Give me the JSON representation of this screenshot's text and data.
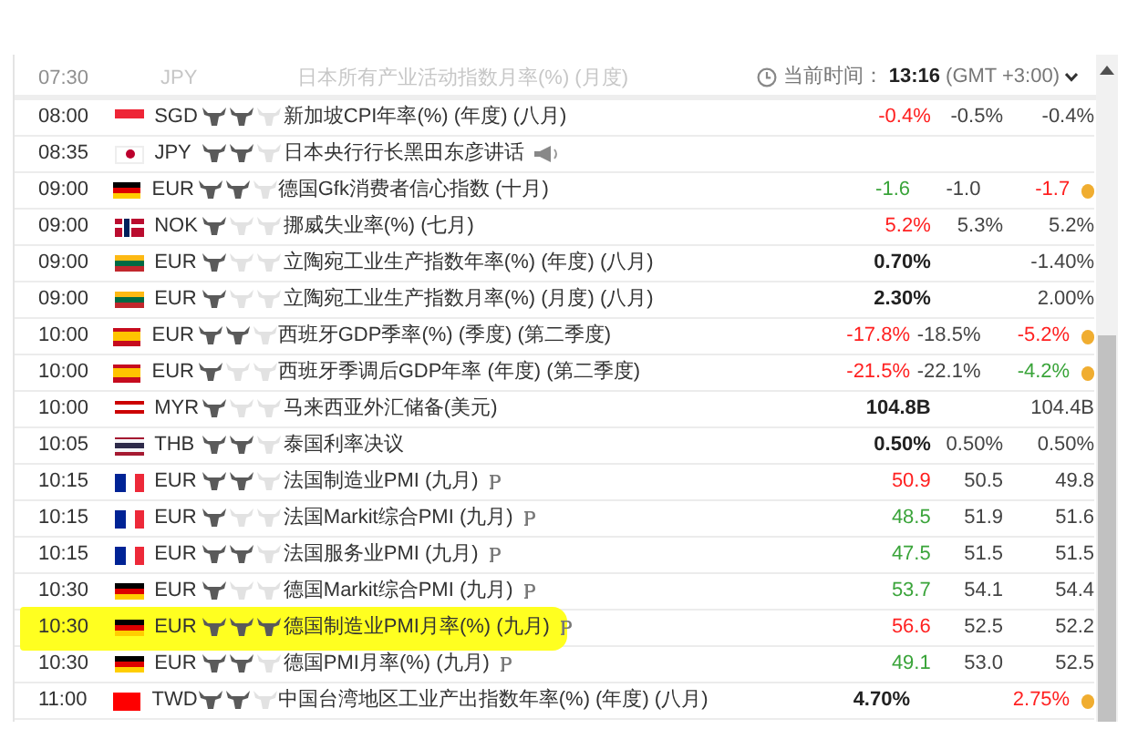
{
  "header": {
    "time_label": "当前时间：",
    "time": "13:16",
    "timezone": "(GMT +3:00)"
  },
  "ghost_row": {
    "time": "07:30",
    "currency": "JPY",
    "event": "日本所有产业活动指数月率(%) (月度)",
    "faded": true
  },
  "rows": [
    {
      "time": "08:00",
      "flag": {
        "kind": "sg"
      },
      "currency": "SGD",
      "stars": 2,
      "event": "新加坡CPI年率(%) (年度) (八月)",
      "prelim": false,
      "speech": false,
      "actual": {
        "text": "-0.4%",
        "color": "#ff2020",
        "bold": false
      },
      "forecast": "-0.5%",
      "previous": {
        "text": "-0.4%",
        "color": "#444444"
      },
      "revised": false,
      "highlighted": false
    },
    {
      "time": "08:35",
      "flag": {
        "kind": "jp"
      },
      "currency": "JPY",
      "stars": 2,
      "event": "日本央行行长黑田东彦讲话",
      "prelim": false,
      "speech": true,
      "revised": false,
      "highlighted": false
    },
    {
      "time": "09:00",
      "flag": {
        "kind": "de"
      },
      "currency": "EUR",
      "stars": 2,
      "event": "德国Gfk消费者信心指数 (十月)",
      "prelim": false,
      "speech": false,
      "actual": {
        "text": "-1.6",
        "color": "#3aa43a",
        "bold": false
      },
      "forecast": "-1.0",
      "previous": {
        "text": "-1.7",
        "color": "#ff2020"
      },
      "revised": true,
      "highlighted": false
    },
    {
      "time": "09:00",
      "flag": {
        "kind": "no"
      },
      "currency": "NOK",
      "stars": 1,
      "event": "挪威失业率(%) (七月)",
      "prelim": false,
      "speech": false,
      "actual": {
        "text": "5.2%",
        "color": "#ff2020",
        "bold": false
      },
      "forecast": "5.3%",
      "previous": {
        "text": "5.2%",
        "color": "#444444"
      },
      "revised": false,
      "highlighted": false
    },
    {
      "time": "09:00",
      "flag": {
        "kind": "lt"
      },
      "currency": "EUR",
      "stars": 1,
      "event": "立陶宛工业生产指数年率(%) (年度) (八月)",
      "prelim": false,
      "speech": false,
      "actual": {
        "text": "0.70%",
        "color": "#222222",
        "bold": true
      },
      "previous": {
        "text": "-1.40%",
        "color": "#444444"
      },
      "revised": false,
      "highlighted": false
    },
    {
      "time": "09:00",
      "flag": {
        "kind": "lt"
      },
      "currency": "EUR",
      "stars": 1,
      "event": "立陶宛工业生产指数月率(%) (月度) (八月)",
      "prelim": false,
      "speech": false,
      "actual": {
        "text": "2.30%",
        "color": "#222222",
        "bold": true
      },
      "previous": {
        "text": "2.00%",
        "color": "#444444"
      },
      "revised": false,
      "highlighted": false
    },
    {
      "time": "10:00",
      "flag": {
        "kind": "es"
      },
      "currency": "EUR",
      "stars": 2,
      "event": "西班牙GDP季率(%) (季度) (第二季度)",
      "prelim": false,
      "speech": false,
      "actual": {
        "text": "-17.8%",
        "color": "#ff2020",
        "bold": false
      },
      "forecast": "-18.5%",
      "previous": {
        "text": "-5.2%",
        "color": "#ff2020"
      },
      "revised": true,
      "highlighted": false
    },
    {
      "time": "10:00",
      "flag": {
        "kind": "es"
      },
      "currency": "EUR",
      "stars": 1,
      "event": "西班牙季调后GDP年率 (年度) (第二季度)",
      "prelim": false,
      "speech": false,
      "actual": {
        "text": "-21.5%",
        "color": "#ff2020",
        "bold": false
      },
      "forecast": "-22.1%",
      "previous": {
        "text": "-4.2%",
        "color": "#3aa43a"
      },
      "revised": true,
      "highlighted": false
    },
    {
      "time": "10:00",
      "flag": {
        "kind": "my"
      },
      "currency": "MYR",
      "stars": 1,
      "event": "马来西亚外汇储备(美元)",
      "prelim": false,
      "speech": false,
      "actual": {
        "text": "104.8B",
        "color": "#222222",
        "bold": true
      },
      "previous": {
        "text": "104.4B",
        "color": "#444444"
      },
      "revised": false,
      "highlighted": false
    },
    {
      "time": "10:05",
      "flag": {
        "kind": "th"
      },
      "currency": "THB",
      "stars": 2,
      "event": "泰国利率决议",
      "prelim": false,
      "speech": false,
      "actual": {
        "text": "0.50%",
        "color": "#222222",
        "bold": true
      },
      "forecast": "0.50%",
      "previous": {
        "text": "0.50%",
        "color": "#444444"
      },
      "revised": false,
      "highlighted": false
    },
    {
      "time": "10:15",
      "flag": {
        "kind": "fr"
      },
      "currency": "EUR",
      "stars": 2,
      "event": "法国制造业PMI (九月)",
      "prelim": true,
      "speech": false,
      "actual": {
        "text": "50.9",
        "color": "#ff2020",
        "bold": false
      },
      "forecast": "50.5",
      "previous": {
        "text": "49.8",
        "color": "#444444"
      },
      "revised": false,
      "highlighted": false
    },
    {
      "time": "10:15",
      "flag": {
        "kind": "fr"
      },
      "currency": "EUR",
      "stars": 1,
      "event": "法国Markit综合PMI (九月)",
      "prelim": true,
      "speech": false,
      "actual": {
        "text": "48.5",
        "color": "#3aa43a",
        "bold": false
      },
      "forecast": "51.9",
      "previous": {
        "text": "51.6",
        "color": "#444444"
      },
      "revised": false,
      "highlighted": false
    },
    {
      "time": "10:15",
      "flag": {
        "kind": "fr"
      },
      "currency": "EUR",
      "stars": 2,
      "event": "法国服务业PMI (九月)",
      "prelim": true,
      "speech": false,
      "actual": {
        "text": "47.5",
        "color": "#3aa43a",
        "bold": false
      },
      "forecast": "51.5",
      "previous": {
        "text": "51.5",
        "color": "#444444"
      },
      "revised": false,
      "highlighted": false
    },
    {
      "time": "10:30",
      "flag": {
        "kind": "de"
      },
      "currency": "EUR",
      "stars": 1,
      "event": "德国Markit综合PMI (九月)",
      "prelim": true,
      "speech": false,
      "actual": {
        "text": "53.7",
        "color": "#3aa43a",
        "bold": false
      },
      "forecast": "54.1",
      "previous": {
        "text": "54.4",
        "color": "#444444"
      },
      "revised": false,
      "highlighted": false
    },
    {
      "time": "10:30",
      "flag": {
        "kind": "de"
      },
      "currency": "EUR",
      "stars": 3,
      "event": "德国制造业PMI月率(%) (九月)",
      "prelim": true,
      "speech": false,
      "actual": {
        "text": "56.6",
        "color": "#ff2020",
        "bold": false
      },
      "forecast": "52.5",
      "previous": {
        "text": "52.2",
        "color": "#444444"
      },
      "revised": false,
      "highlighted": true
    },
    {
      "time": "10:30",
      "flag": {
        "kind": "de"
      },
      "currency": "EUR",
      "stars": 2,
      "event": "德国PMI月率(%) (九月)",
      "prelim": true,
      "speech": false,
      "actual": {
        "text": "49.1",
        "color": "#3aa43a",
        "bold": false
      },
      "forecast": "53.0",
      "previous": {
        "text": "52.5",
        "color": "#444444"
      },
      "revised": false,
      "highlighted": false
    },
    {
      "time": "11:00",
      "flag": {
        "kind": "tw"
      },
      "currency": "TWD",
      "stars": 2,
      "event": "中国台湾地区工业产出指数年率(%) (年度) (八月)",
      "prelim": false,
      "speech": false,
      "actual": {
        "text": "4.70%",
        "color": "#222222",
        "bold": true
      },
      "previous": {
        "text": "2.75%",
        "color": "#ff2020"
      },
      "revised": true,
      "highlighted": false
    }
  ]
}
